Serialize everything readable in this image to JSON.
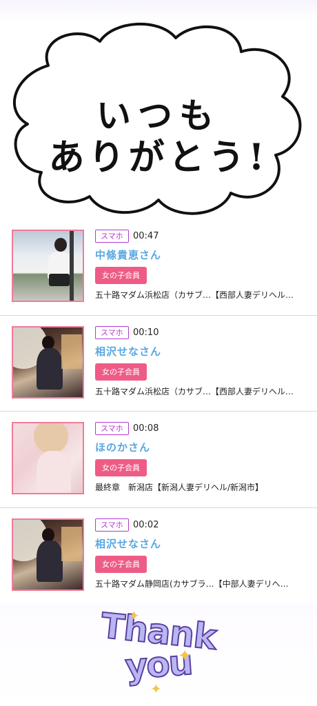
{
  "top_banner": {
    "line1": "いつも",
    "line2": "ありがとう!"
  },
  "entries": [
    {
      "badge": "スマホ",
      "time": "00:47",
      "name": "中條貴恵さん",
      "member_label": "女の子会員",
      "shop": "五十路マダム浜松店（カサブ…【西部人妻デリヘル…"
    },
    {
      "badge": "スマホ",
      "time": "00:10",
      "name": "相沢せなさん",
      "member_label": "女の子会員",
      "shop": "五十路マダム浜松店（カサブ…【西部人妻デリヘル…"
    },
    {
      "badge": "スマホ",
      "time": "00:08",
      "name": "ほのかさん",
      "member_label": "女の子会員",
      "shop": "最終章　新潟店【新潟人妻デリヘル/新潟市】"
    },
    {
      "badge": "スマホ",
      "time": "00:02",
      "name": "相沢せなさん",
      "member_label": "女の子会員",
      "shop": "五十路マダム静岡店(カサブラ…【中部人妻デリへ…"
    }
  ],
  "bottom_banner": {
    "line1": "Thank",
    "line2": "you"
  },
  "colors": {
    "badge_border": "#b03ad0",
    "name": "#58a7e0",
    "member_button": "#ee5c86",
    "thumb_border": "#f07a9b"
  }
}
